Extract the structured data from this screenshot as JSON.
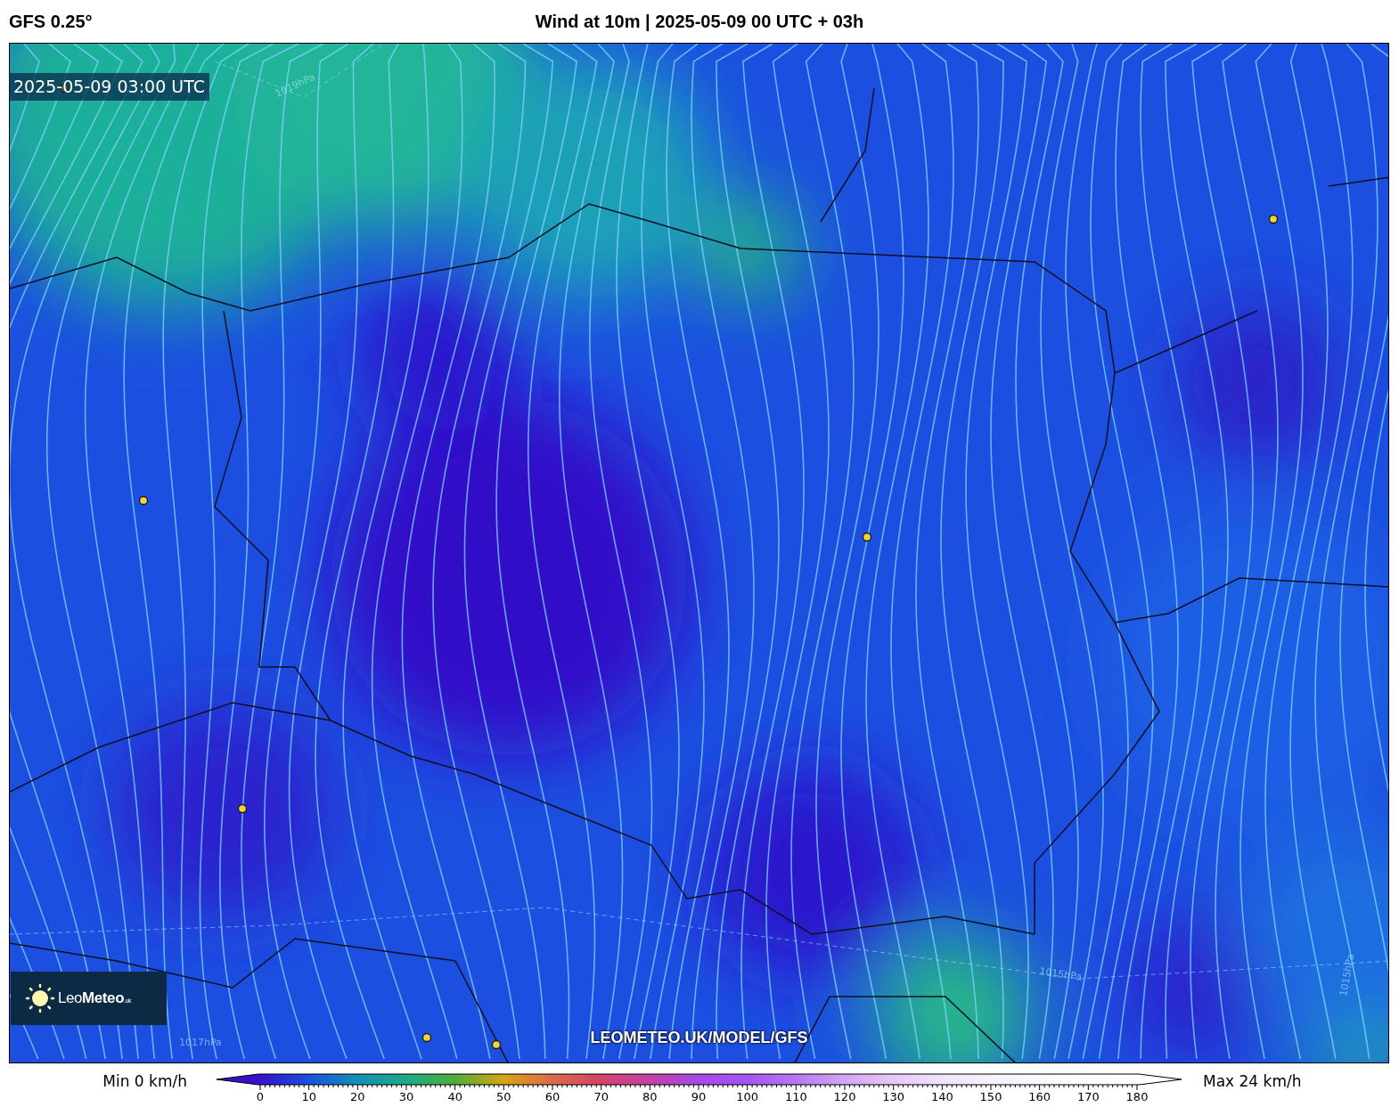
{
  "header": {
    "model": "GFS 0.25°",
    "title": "Wind at 10m | 2025-05-09 00 UTC + 03h"
  },
  "map": {
    "timestamp": "2025-05-09 03:00 UTC",
    "isobar_labels": [
      "1019hPa",
      "1017hPa",
      "1015hPa",
      "1015hPa"
    ],
    "logo": {
      "light": "Leo",
      "bold": "Meteo",
      "suffix": ".uk"
    },
    "url": "LEOMETEO.UK/MODEL/GFS"
  },
  "legend": {
    "min_label": "Min 0 km/h",
    "max_label": "Max 24 km/h",
    "ticks": [
      "0",
      "10",
      "20",
      "30",
      "40",
      "50",
      "60",
      "70",
      "80",
      "90",
      "100",
      "110",
      "120",
      "130",
      "140",
      "150",
      "160",
      "170",
      "180"
    ]
  }
}
